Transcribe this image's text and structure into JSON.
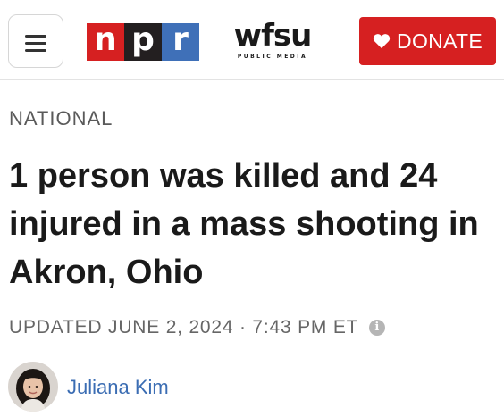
{
  "header": {
    "menu_icon": "hamburger-menu-icon",
    "npr_logo": [
      "n",
      "p",
      "r"
    ],
    "wfsu_logo": "wfsu",
    "wfsu_tagline": "PUBLIC MEDIA",
    "donate_label": "DONATE",
    "donate_icon": "heart-icon",
    "colors": {
      "npr_red": "#d62021",
      "npr_black": "#231f20",
      "npr_blue": "#3f70b8",
      "donate_bg": "#d62021"
    }
  },
  "article": {
    "section": "NATIONAL",
    "headline": "1 person was killed and 24 injured in a mass shooting in Akron, Ohio",
    "dateline": "UPDATED JUNE 2, 2024 · 7:43 PM ET",
    "info_icon": "info-icon",
    "author": "Juliana Kim",
    "author_color": "#3b6db3"
  }
}
